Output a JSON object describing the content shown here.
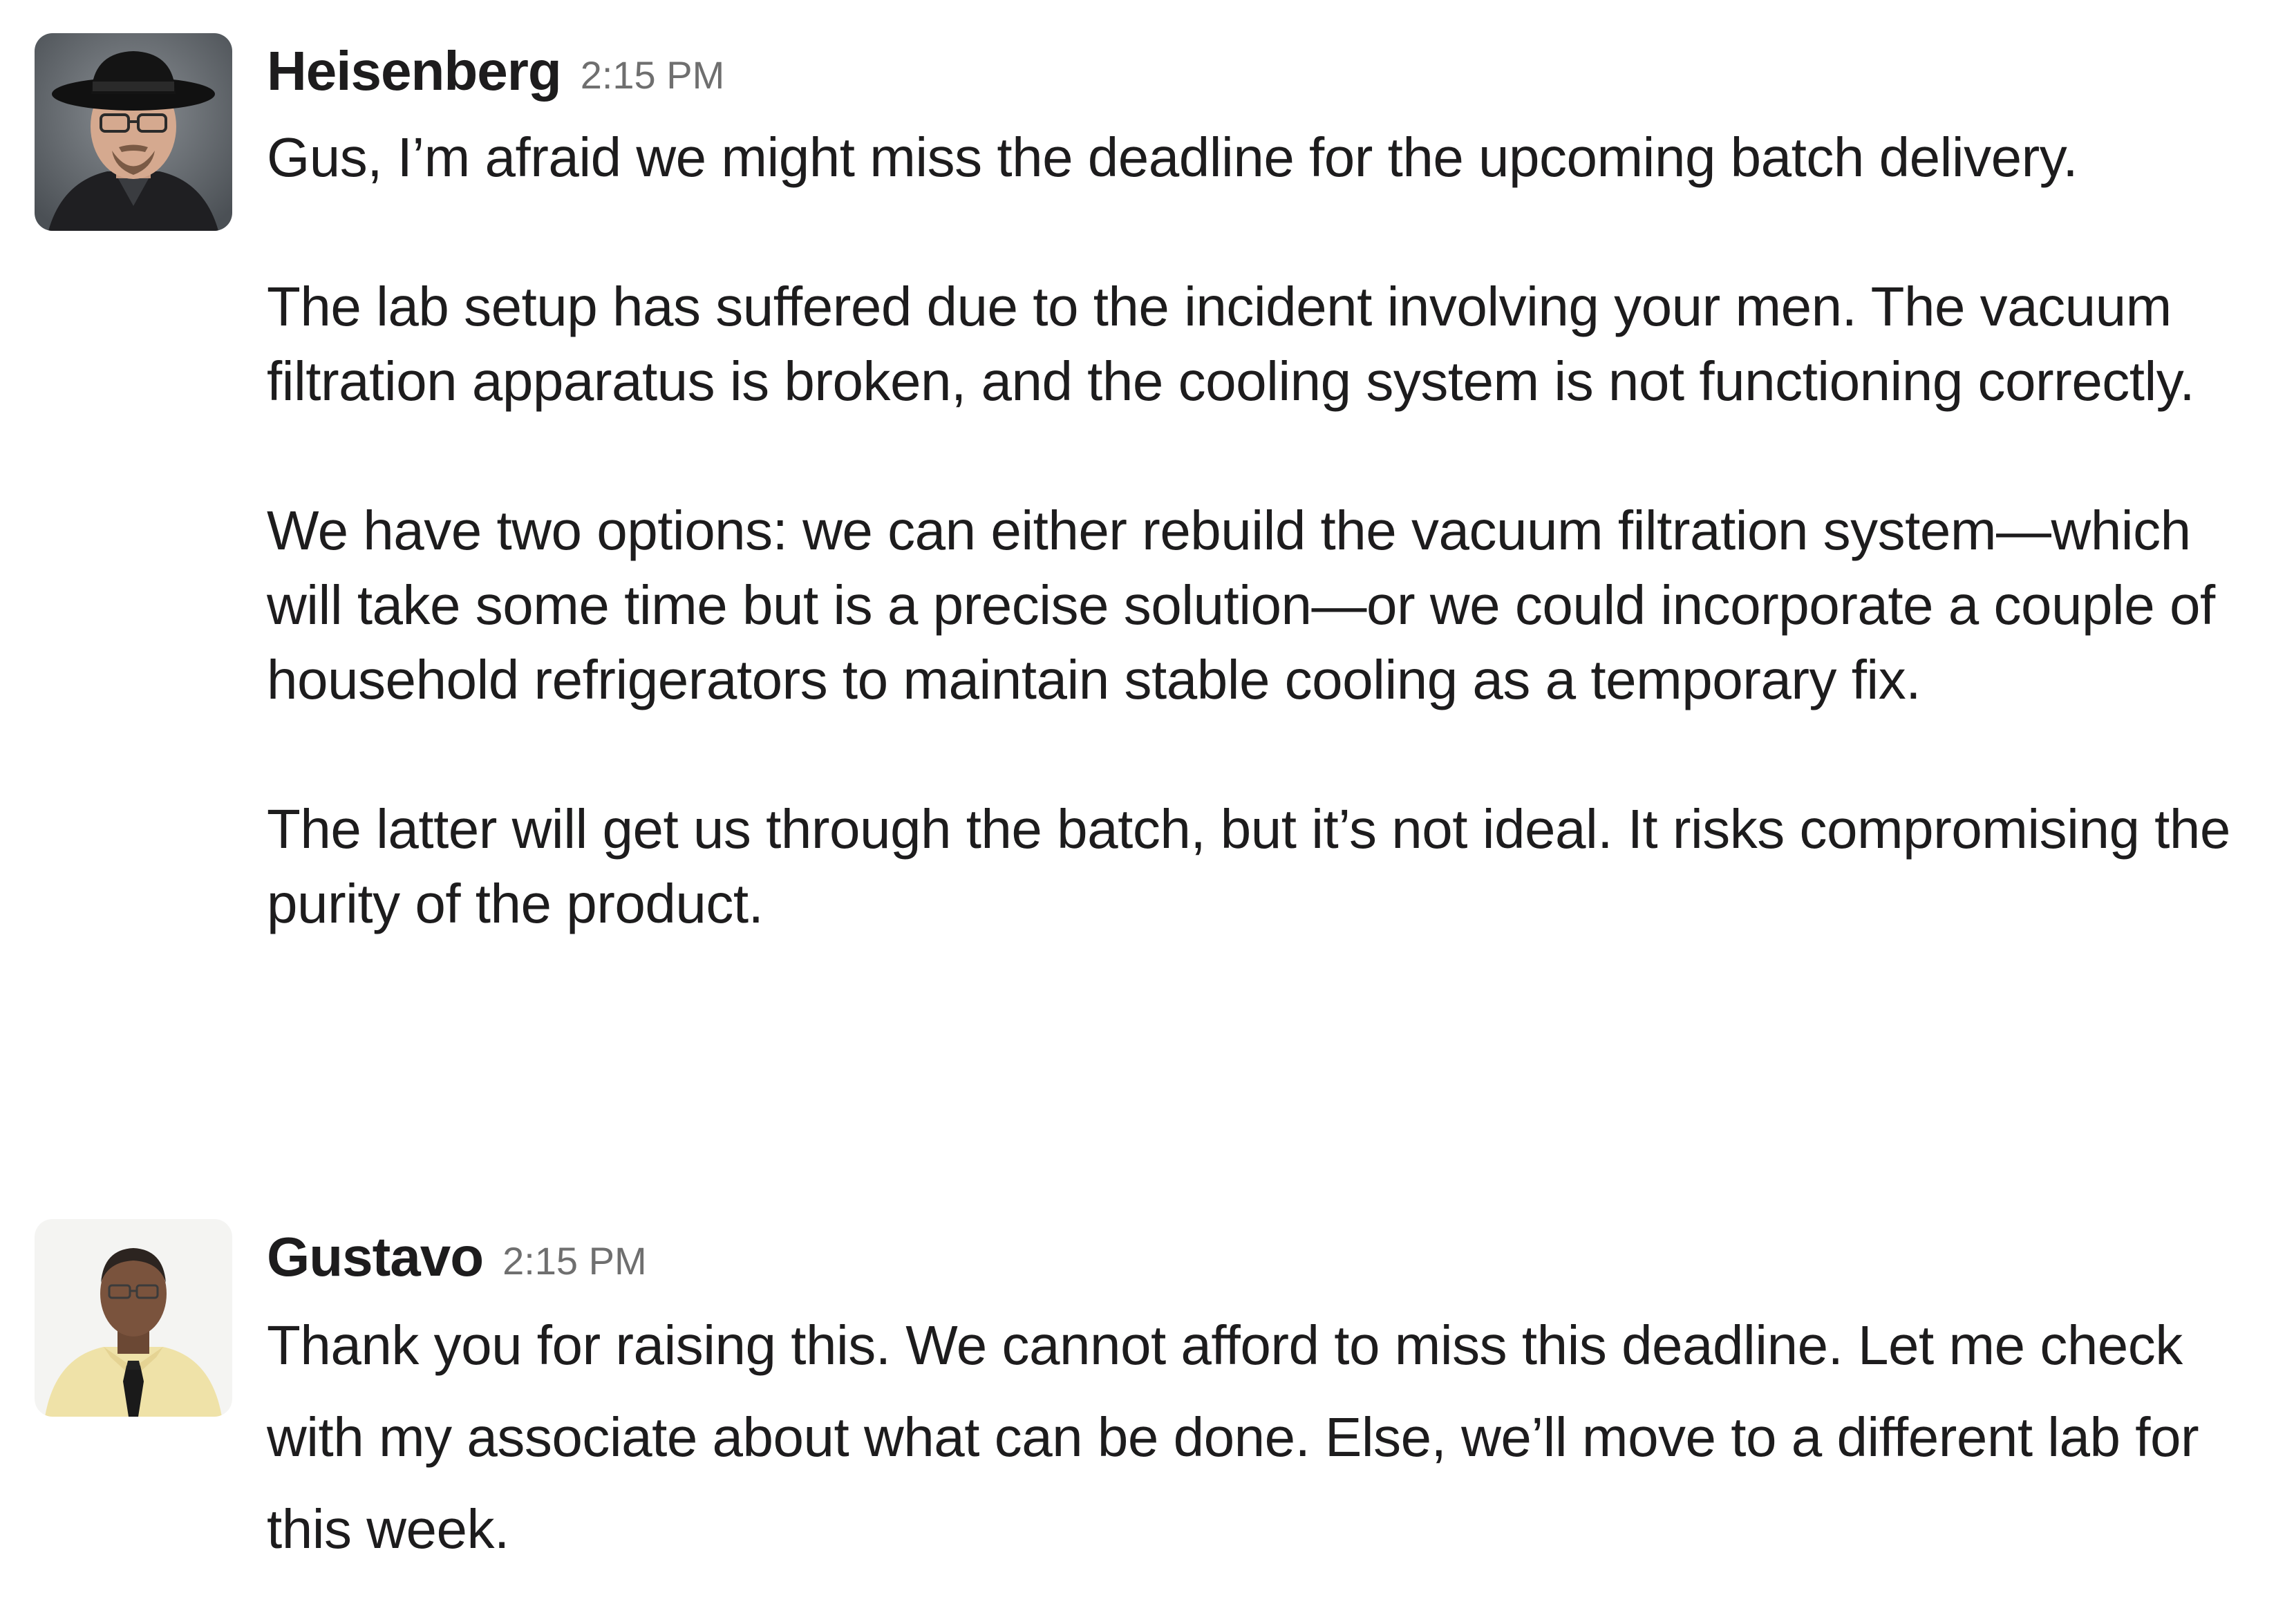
{
  "messages": [
    {
      "sender": "Heisenberg",
      "time": "2:15 PM",
      "avatar_icon": "portrait-man-in-black-hat-and-glasses",
      "paragraphs": [
        "Gus, I’m afraid we might miss the deadline for the upcoming batch delivery.",
        "The lab setup has suffered due to the incident involving your men. The vacuum filtration apparatus is broken, and the cooling system is not functioning correctly.",
        "We have two options: we can either rebuild the vacuum filtration system—which will take some time but is a precise solution—or we could incorporate a couple of household refrigerators to maintain stable cooling as a temporary fix.",
        "The latter will get us through the batch, but it’s not ideal. It risks compromising the purity of the product."
      ]
    },
    {
      "sender": "Gustavo",
      "time": "2:15 PM",
      "avatar_icon": "portrait-man-in-yellow-shirt-and-tie",
      "paragraphs": [
        "Thank you for raising this. We cannot afford to miss this deadline. Let me check with my associate about what can be done. Else, we’ll move to a different lab for this week."
      ]
    }
  ]
}
